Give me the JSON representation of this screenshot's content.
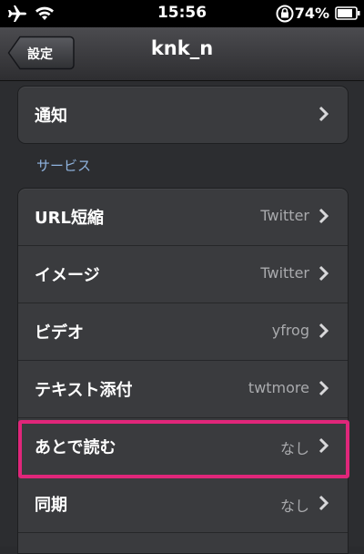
{
  "status_bar": {
    "time": "15:56",
    "battery": "74%"
  },
  "nav": {
    "back_label": "設定",
    "title": "knk_n"
  },
  "groups": {
    "notification": {
      "label": "通知"
    },
    "services_header": "サービス",
    "services": [
      {
        "label": "URL短縮",
        "value": "Twitter"
      },
      {
        "label": "イメージ",
        "value": "Twitter"
      },
      {
        "label": "ビデオ",
        "value": "yfrog"
      },
      {
        "label": "テキスト添付",
        "value": "twtmore"
      },
      {
        "label": "あとで読む",
        "value": "なし"
      },
      {
        "label": "同期",
        "value": "なし"
      }
    ]
  },
  "colors": {
    "highlight": "#e0267a",
    "section_header": "#8fb3de"
  }
}
